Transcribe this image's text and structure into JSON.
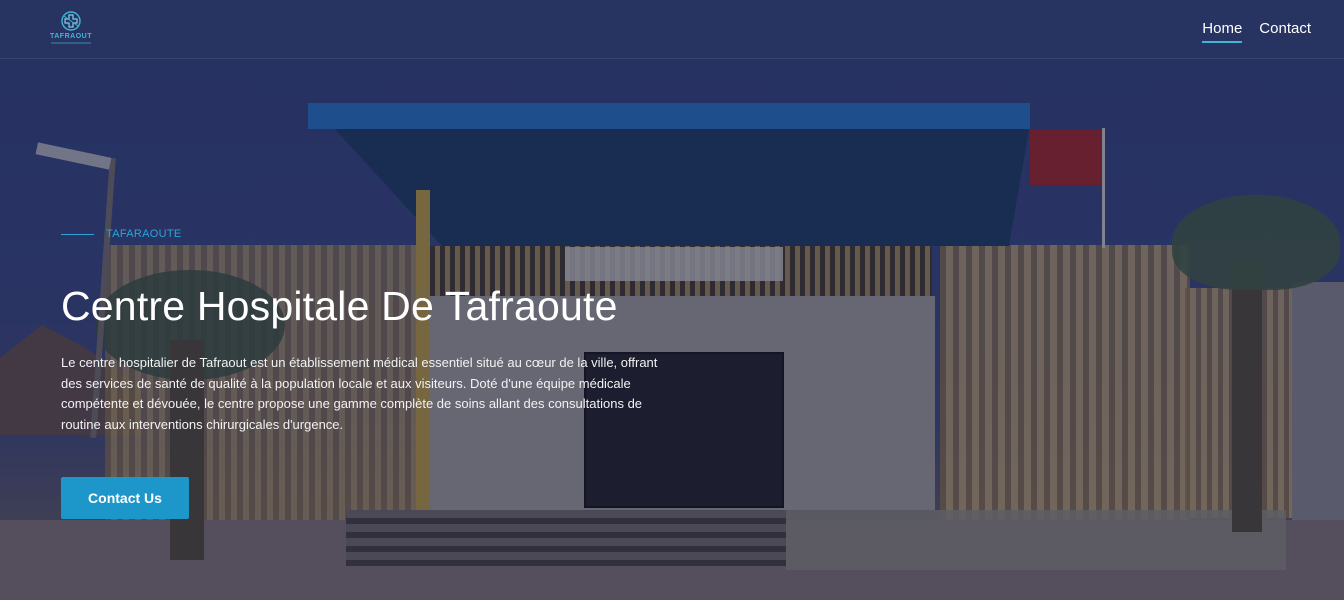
{
  "header": {
    "logo": {
      "name": "TAFRAOUT",
      "icon": "hospital-cross-emblem-icon"
    },
    "nav": [
      {
        "label": "Home",
        "active": true
      },
      {
        "label": "Contact",
        "active": false
      }
    ]
  },
  "hero": {
    "eyebrow": "TAFARAOUTE",
    "title": "Centre Hospitale De Tafraoute",
    "description": "Le centre hospitalier de Tafraout est un établissement médical essentiel situé au cœur de la ville, offrant des services de santé de qualité à la population locale et aux visiteurs. Doté d'une équipe médicale compétente et dévouée, le centre propose une gamme complète de soins allant des consultations de routine aux interventions chirurgicales d'urgence.",
    "cta_label": "Contact Us",
    "background_image": "hospital-building-photo"
  },
  "colors": {
    "accent": "#1d96c9",
    "eyebrow": "#2aa5d8",
    "overlay": "#1c2242"
  }
}
